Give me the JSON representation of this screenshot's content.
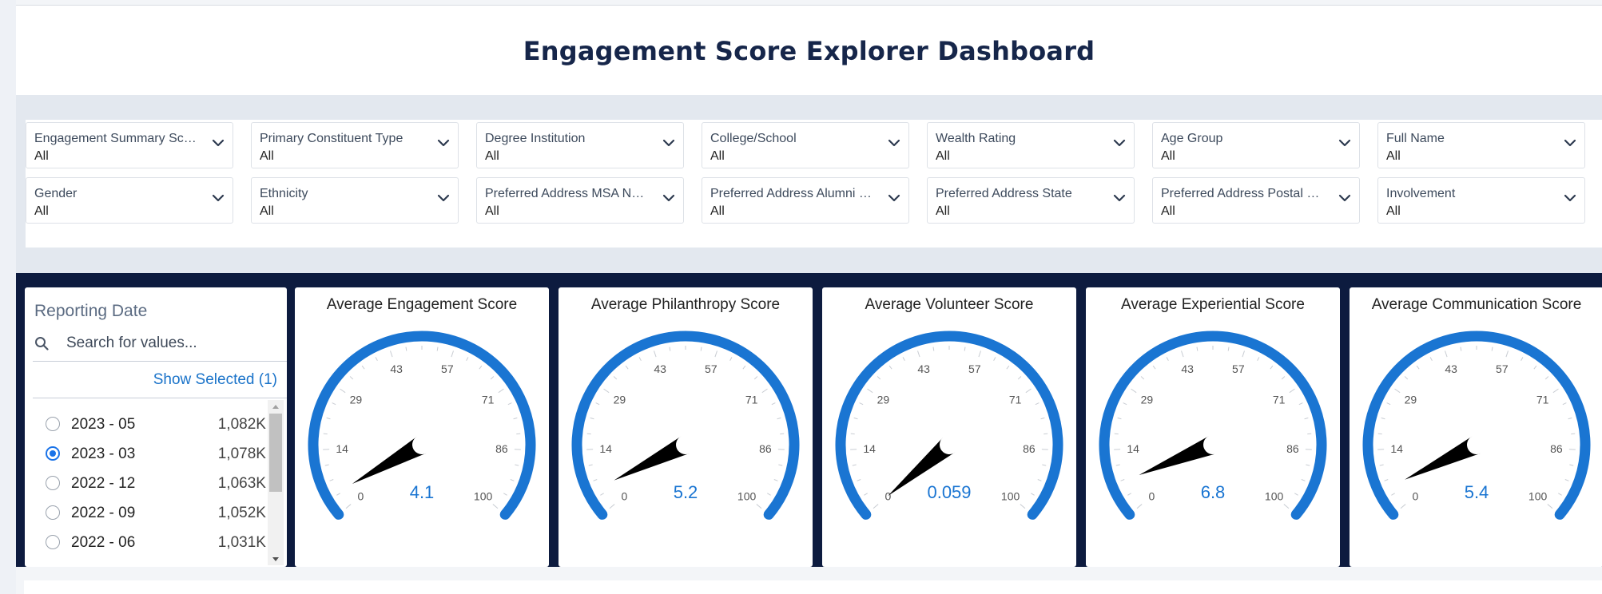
{
  "dashboard": {
    "title": "Engagement Score Explorer Dashboard"
  },
  "filters": [
    {
      "label": "Engagement Summary Scor...",
      "value": "All"
    },
    {
      "label": "Primary Constituent Type",
      "value": "All"
    },
    {
      "label": "Degree Institution",
      "value": "All"
    },
    {
      "label": "College/School",
      "value": "All"
    },
    {
      "label": "Wealth Rating",
      "value": "All"
    },
    {
      "label": "Age Group",
      "value": "All"
    },
    {
      "label": "Full Name",
      "value": "All"
    },
    {
      "label": "Gender",
      "value": "All"
    },
    {
      "label": "Ethnicity",
      "value": "All"
    },
    {
      "label": "Preferred Address MSA Na...",
      "value": "All"
    },
    {
      "label": "Preferred Address Alumni C...",
      "value": "All"
    },
    {
      "label": "Preferred Address State",
      "value": "All"
    },
    {
      "label": "Preferred Address Postal C...",
      "value": "All"
    },
    {
      "label": "Involvement",
      "value": "All"
    }
  ],
  "reporting_date": {
    "title": "Reporting Date",
    "search_placeholder": "Search for values...",
    "show_selected": "Show Selected (1)",
    "options": [
      {
        "label": "2023 - 05",
        "count": "1,082K",
        "selected": false
      },
      {
        "label": "2023 - 03",
        "count": "1,078K",
        "selected": true
      },
      {
        "label": "2022 - 12",
        "count": "1,063K",
        "selected": false
      },
      {
        "label": "2022 - 09",
        "count": "1,052K",
        "selected": false
      },
      {
        "label": "2022 - 06",
        "count": "1,031K",
        "selected": false
      }
    ]
  },
  "gauges": [
    {
      "title": "Average Engagement Score",
      "value": 4.1,
      "display": "4.1"
    },
    {
      "title": "Average Philanthropy Score",
      "value": 5.2,
      "display": "5.2"
    },
    {
      "title": "Average Volunteer Score",
      "value": 0.059,
      "display": "0.059"
    },
    {
      "title": "Average Experiential Score",
      "value": 6.8,
      "display": "6.8"
    },
    {
      "title": "Average Communication Score",
      "value": 5.4,
      "display": "5.4"
    }
  ],
  "gauge_scale": {
    "min": 0,
    "max": 100,
    "ticks": [
      "0",
      "14",
      "29",
      "43",
      "57",
      "71",
      "86",
      "100"
    ],
    "arc_color": "#1a75d2",
    "needle_color": "#000000",
    "value_color": "#1a75d2"
  },
  "colors": {
    "navy": "#0d1b3f",
    "title": "#16264a",
    "link": "#1a73c9"
  }
}
